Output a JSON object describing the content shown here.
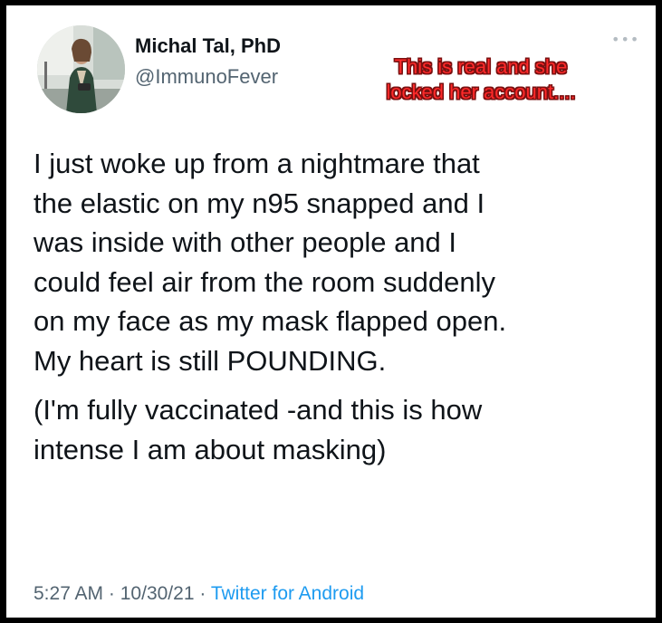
{
  "tweet": {
    "author_name": "Michal Tal, PhD",
    "handle": "@ImmunoFever",
    "more_icon": "more-options-icon",
    "text_lines": [
      "I just woke up from a nightmare that",
      "the elastic on my n95 snapped and I",
      "was inside with other people and I",
      "could feel air from the room suddenly",
      "on my face as my mask flapped open.",
      "My heart is still POUNDING."
    ],
    "text_lines_2": [
      "(I'm fully vaccinated -and this is how",
      "intense I am about masking)"
    ],
    "time": "5:27 AM",
    "separator": "·",
    "date": "10/30/21",
    "source": "Twitter for Android"
  },
  "annotation": {
    "lines": [
      "This is real and she",
      "locked her account...."
    ]
  },
  "colors": {
    "text": "#0f1419",
    "muted": "#536471",
    "link": "#1d9bf0",
    "annotation": "#ff2a2a",
    "border": "#000000"
  }
}
